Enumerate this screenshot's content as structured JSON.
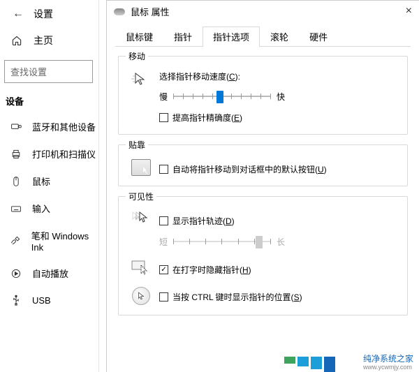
{
  "settings": {
    "title": "设置",
    "home": "主页",
    "search_placeholder": "查找设置",
    "section": "设备",
    "nav": [
      {
        "icon": "bluetooth",
        "label": "蓝牙和其他设备"
      },
      {
        "icon": "printer",
        "label": "打印机和扫描仪"
      },
      {
        "icon": "mouse",
        "label": "鼠标"
      },
      {
        "icon": "keyboard",
        "label": "输入"
      },
      {
        "icon": "pen",
        "label": "笔和 Windows Ink"
      },
      {
        "icon": "autoplay",
        "label": "自动播放"
      },
      {
        "icon": "usb",
        "label": "USB"
      }
    ]
  },
  "dialog": {
    "title": "鼠标 属性",
    "tabs": [
      "鼠标键",
      "指针",
      "指针选项",
      "滚轮",
      "硬件"
    ],
    "active_tab": 2,
    "motion": {
      "group": "移动",
      "speed_label_pre": "选择指针移动速度(",
      "speed_key": "C",
      "speed_label_post": "):",
      "slow": "慢",
      "fast": "快",
      "enhance_pre": "提高指针精确度(",
      "enhance_key": "E",
      "enhance_post": ")",
      "enhance_checked": false
    },
    "snap": {
      "group": "贴靠",
      "label_pre": "自动将指针移动到对话框中的默认按钮(",
      "label_key": "U",
      "label_post": ")",
      "checked": false
    },
    "visibility": {
      "group": "可见性",
      "trail_pre": "显示指针轨迹(",
      "trail_key": "D",
      "trail_post": ")",
      "trail_checked": false,
      "short": "短",
      "long": "长",
      "hide_pre": "在打字时隐藏指针(",
      "hide_key": "H",
      "hide_post": ")",
      "hide_checked": true,
      "ctrl_pre": "当按 CTRL 键时显示指针的位置(",
      "ctrl_key": "S",
      "ctrl_post": ")",
      "ctrl_checked": false
    }
  },
  "watermark": {
    "name": "纯净系统之家",
    "url": "www.ycwmjy.com"
  }
}
